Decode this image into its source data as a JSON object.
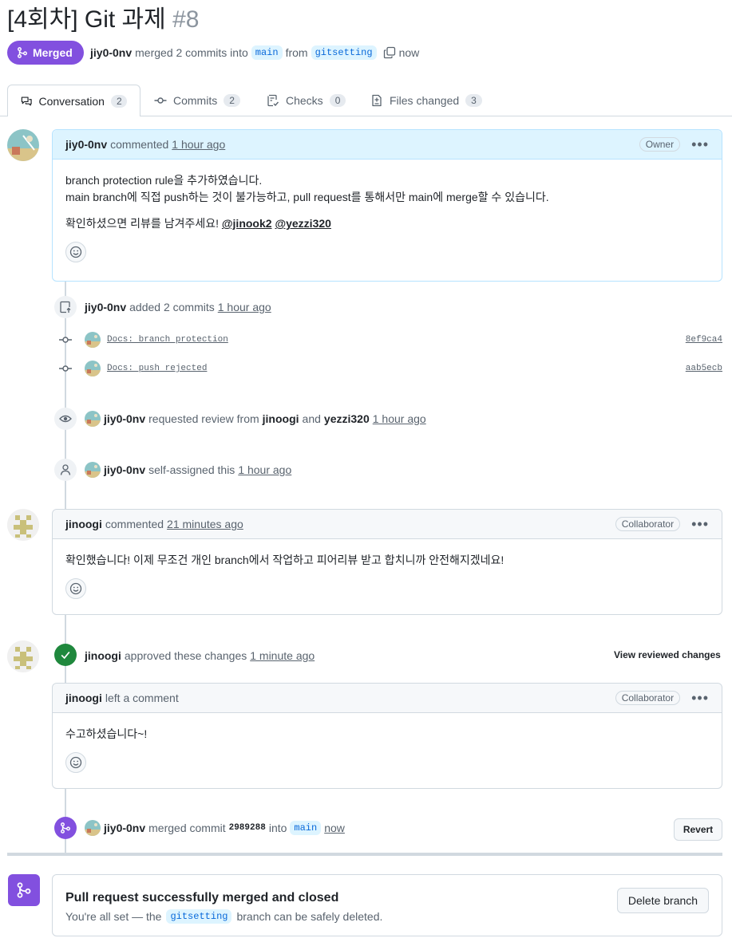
{
  "pr": {
    "title": "[4회차] Git 과제",
    "number": "#8",
    "status": "Merged",
    "author": "jiy0-0nv",
    "merge_text": "merged 2 commits into",
    "base_branch": "main",
    "from_text": "from",
    "head_branch": "gitsetting",
    "time": "now"
  },
  "tabs": [
    {
      "label": "Conversation",
      "count": "2",
      "icon": "comment-discussion-icon"
    },
    {
      "label": "Commits",
      "count": "2",
      "icon": "git-commit-icon"
    },
    {
      "label": "Checks",
      "count": "0",
      "icon": "checklist-icon"
    },
    {
      "label": "Files changed",
      "count": "3",
      "icon": "file-diff-icon"
    }
  ],
  "comment1": {
    "author": "jiy0-0nv",
    "action": "commented",
    "time": "1 hour ago",
    "role": "Owner",
    "line1": "branch protection rule을 추가하였습니다.",
    "line2": "main branch에 직접 push하는 것이 불가능하고, pull request를 통해서만 main에 merge할 수 있습니다.",
    "line3": "확인하셨으면 리뷰를 남겨주세요!",
    "mention1": "@jinook2",
    "mention2": "@yezzi320"
  },
  "commits_event": {
    "author": "jiy0-0nv",
    "action": "added 2 commits",
    "time": "1 hour ago",
    "commits": [
      {
        "message": "Docs: branch protection",
        "sha": "8ef9ca4"
      },
      {
        "message": "Docs: push rejected",
        "sha": "aab5ecb"
      }
    ]
  },
  "review_request": {
    "author": "jiy0-0nv",
    "action": "requested review from",
    "reviewer1": "jinoogi",
    "and": "and",
    "reviewer2": "yezzi320",
    "time": "1 hour ago"
  },
  "assign_event": {
    "author": "jiy0-0nv",
    "action": "self-assigned this",
    "time": "1 hour ago"
  },
  "comment2": {
    "author": "jinoogi",
    "action": "commented",
    "time": "21 minutes ago",
    "role": "Collaborator",
    "body": "확인했습니다! 이제 무조건 개인 branch에서 작업하고 피어리뷰 받고 합치니까 안전해지겠네요!"
  },
  "approval": {
    "author": "jinoogi",
    "action": "approved these changes",
    "time": "1 minute ago",
    "view_button": "View reviewed changes"
  },
  "review_comment": {
    "author": "jinoogi",
    "action": "left a comment",
    "role": "Collaborator",
    "body": "수고하셨습니다~!"
  },
  "merge_event": {
    "author": "jiy0-0nv",
    "action": "merged commit",
    "sha": "2989288",
    "into": "into",
    "branch": "main",
    "time": "now",
    "revert_button": "Revert"
  },
  "final": {
    "title": "Pull request successfully merged and closed",
    "desc_before": "You're all set — the",
    "branch": "gitsetting",
    "desc_after": "branch can be safely deleted.",
    "delete_button": "Delete branch"
  },
  "colors": {
    "merged_purple": "#8250df",
    "approved_green": "#1f883d",
    "link_blue": "#0969da",
    "border": "#d1d9e0"
  }
}
